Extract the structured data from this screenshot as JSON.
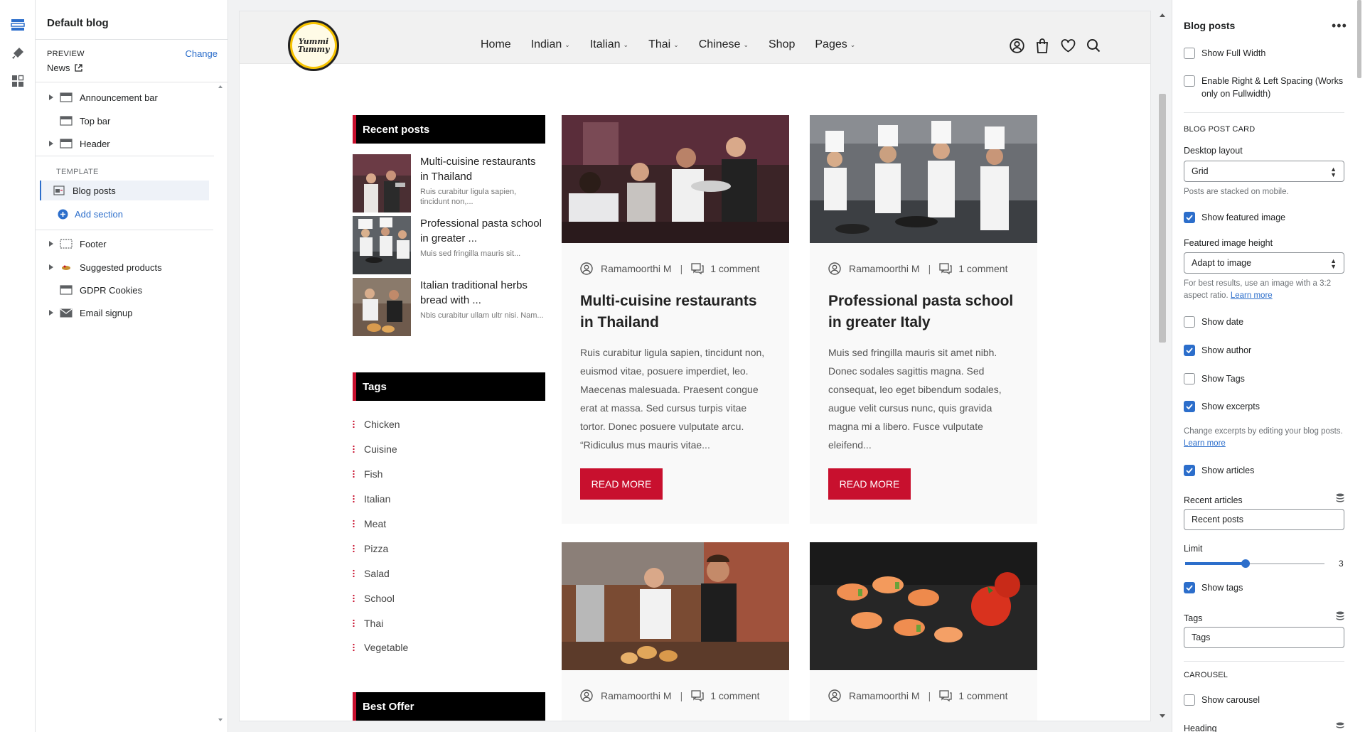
{
  "left_panel": {
    "title": "Default blog",
    "preview_label": "PREVIEW",
    "preview_change": "Change",
    "preview_page": "News",
    "sections": [
      "Announcement bar",
      "Top bar",
      "Header"
    ],
    "template_label": "TEMPLATE",
    "template_item": "Blog posts",
    "add_section": "Add section",
    "footer_sections": [
      "Footer",
      "Suggested products",
      "GDPR Cookies",
      "Email signup"
    ]
  },
  "site": {
    "logo_text": "Yummi Tummy",
    "nav": [
      "Home",
      "Indian",
      "Italian",
      "Thai",
      "Chinese",
      "Shop",
      "Pages"
    ],
    "nav_has_dropdown": [
      false,
      true,
      true,
      true,
      true,
      false,
      true
    ]
  },
  "sidebar": {
    "recent_title": "Recent posts",
    "recent_posts": [
      {
        "title": "Multi-cuisine restaurants in Thailand",
        "excerpt": "Ruis curabitur ligula sapien, tincidunt non,..."
      },
      {
        "title": "Professional pasta school in greater ...",
        "excerpt": "Muis sed fringilla mauris sit..."
      },
      {
        "title": "Italian traditional herbs bread with ...",
        "excerpt": "Nbis curabitur ullam ultr nisi. Nam..."
      }
    ],
    "tags_title": "Tags",
    "tags": [
      "Chicken",
      "Cuisine",
      "Fish",
      "Italian",
      "Meat",
      "Pizza",
      "Salad",
      "School",
      "Thai",
      "Vegetable"
    ],
    "offer_title": "Best Offer"
  },
  "posts": [
    {
      "author": "Ramamoorthi M",
      "comments": "1 comment",
      "title": "Multi-cuisine restaurants in Thailand",
      "excerpt": "Ruis curabitur ligula sapien, tincidunt non, euismod vitae, posuere imperdiet, leo. Maecenas malesuada. Praesent congue erat at massa. Sed cursus turpis vitae tortor. Donec posuere vulputate arcu.  “Ridiculus mus mauris vitae...",
      "button": "READ MORE"
    },
    {
      "author": "Ramamoorthi M",
      "comments": "1 comment",
      "title": "Professional pasta school in greater Italy",
      "excerpt": "Muis sed fringilla mauris sit amet nibh. Donec sodales sagittis magna. Sed consequat, leo eget bibendum sodales, augue velit cursus nunc, quis gravida magna mi a libero. Fusce vulputate eleifend...",
      "button": "READ MORE"
    },
    {
      "author": "Ramamoorthi M",
      "comments": "1 comment"
    },
    {
      "author": "Ramamoorthi M",
      "comments": "1 comment"
    }
  ],
  "right_panel": {
    "title": "Blog posts",
    "show_full_width": {
      "label": "Show Full Width",
      "checked": false
    },
    "enable_spacing": {
      "label": "Enable Right & Left Spacing (Works only on Fullwidth)",
      "checked": false
    },
    "card_heading": "BLOG POST CARD",
    "desktop_layout_label": "Desktop layout",
    "desktop_layout_value": "Grid",
    "desktop_layout_help": "Posts are stacked on mobile.",
    "show_featured_image": {
      "label": "Show featured image",
      "checked": true
    },
    "featured_height_label": "Featured image height",
    "featured_height_value": "Adapt to image",
    "featured_height_help": "For best results, use an image with a 3:2 aspect ratio.",
    "learn_more": "Learn more",
    "show_date": {
      "label": "Show date",
      "checked": false
    },
    "show_author": {
      "label": "Show author",
      "checked": true
    },
    "show_tags": {
      "label": "Show Tags",
      "checked": false
    },
    "show_excerpts": {
      "label": "Show excerpts",
      "checked": true
    },
    "excerpts_help": "Change excerpts by editing your blog posts.",
    "show_articles": {
      "label": "Show articles",
      "checked": true
    },
    "recent_articles_label": "Recent articles",
    "recent_articles_value": "Recent posts",
    "limit_label": "Limit",
    "limit_value": 3,
    "limit_fraction": 0.5,
    "show_tags2": {
      "label": "Show tags",
      "checked": true
    },
    "tags_label": "Tags",
    "tags_value": "Tags",
    "carousel_heading": "CAROUSEL",
    "show_carousel": {
      "label": "Show carousel",
      "checked": false
    },
    "heading_label": "Heading"
  },
  "colors": {
    "accent": "#c8102e",
    "editor_blue": "#2c6ecb",
    "logo_yellow": "#f7c300"
  }
}
